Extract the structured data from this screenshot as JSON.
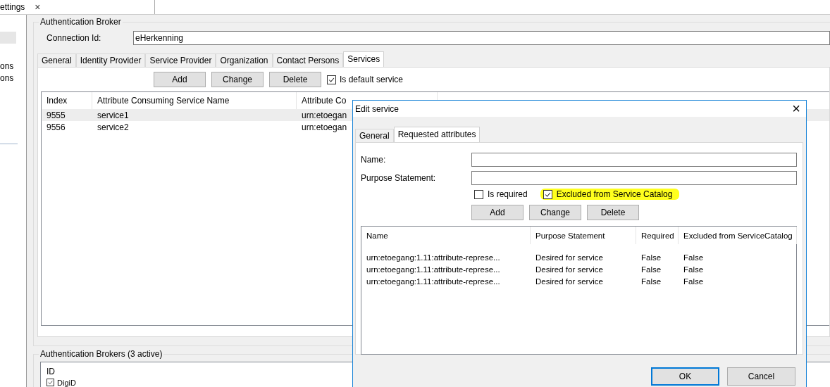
{
  "doc_tab": {
    "title": "ettings",
    "close": "×"
  },
  "sidebar": {
    "items": [
      {
        "selected": true
      },
      {
        "label": "ons",
        "selected": false
      },
      {
        "label": "ons",
        "selected": false
      }
    ]
  },
  "broker": {
    "title": "Authentication Broker",
    "connection_label": "Connection Id:",
    "connection_value": "eHerkenning",
    "tabs": [
      {
        "label": "General",
        "selected": false
      },
      {
        "label": "Identity Provider",
        "selected": false
      },
      {
        "label": "Service Provider",
        "selected": false
      },
      {
        "label": "Organization",
        "selected": false
      },
      {
        "label": "Contact Persons",
        "selected": false
      },
      {
        "label": "Services",
        "selected": true
      }
    ],
    "buttons": [
      "Add",
      "Change",
      "Delete"
    ],
    "default_checkbox": {
      "label": "Is default service",
      "checked": true
    },
    "table": {
      "columns": [
        "Index",
        "Attribute Consuming Service Name",
        "Attribute Co"
      ],
      "rows": [
        {
          "cells": [
            "9555",
            "service1",
            "urn:etoegan"
          ],
          "selected": true
        },
        {
          "cells": [
            "9556",
            "service2",
            "urn:etoegan"
          ],
          "selected": false
        }
      ]
    }
  },
  "brokers": {
    "title": "Authentication Brokers (3 active)",
    "column": "ID",
    "rows": [
      {
        "label": "DigiD",
        "checked": true
      }
    ]
  },
  "dialog": {
    "title": "Edit service",
    "close": "×",
    "tabs": [
      {
        "label": "General",
        "selected": false
      },
      {
        "label": "Requested attributes",
        "selected": true
      }
    ],
    "name_label": "Name:",
    "purpose_label": "Purpose Statement:",
    "checkboxes": [
      {
        "label": "Is required",
        "checked": false,
        "highlighted": false
      },
      {
        "label": "Excluded from Service Catalog",
        "checked": true,
        "highlighted": true
      }
    ],
    "buttons": [
      "Add",
      "Change",
      "Delete"
    ],
    "table": {
      "columns": [
        "Name",
        "Purpose Statement",
        "Required",
        "Excluded from ServiceCatalog"
      ],
      "rows": [
        {
          "cells": [
            "urn:etoegang:1.11:attribute-represe...",
            "Desired for service",
            "False",
            "False"
          ]
        },
        {
          "cells": [
            "urn:etoegang:1.11:attribute-represe...",
            "Desired for service",
            "False",
            "False"
          ]
        },
        {
          "cells": [
            "urn:etoegang:1.11:attribute-represe...",
            "Desired for service",
            "False",
            "False"
          ]
        }
      ]
    },
    "footer_buttons": [
      {
        "label": "OK",
        "default": true
      },
      {
        "label": "Cancel",
        "default": false
      }
    ]
  }
}
